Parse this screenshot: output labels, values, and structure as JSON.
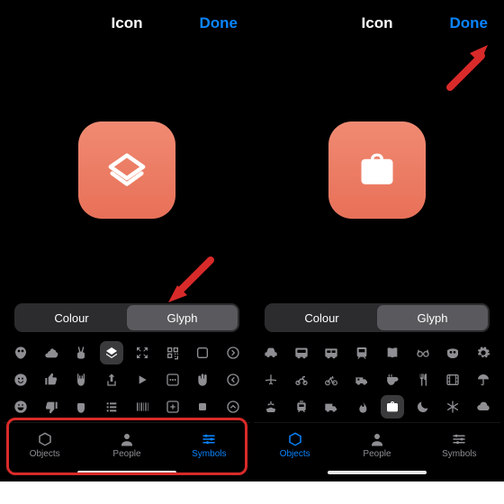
{
  "header": {
    "title": "Icon",
    "done": "Done"
  },
  "segmented": {
    "colour": "Colour",
    "glyph": "Glyph"
  },
  "tabs": {
    "objects": "Objects",
    "people": "People",
    "symbols": "Symbols"
  },
  "accent_color": "#ed7e66",
  "left": {
    "selected_glyph": "shortcuts-layers",
    "active_tab": "symbols"
  },
  "right": {
    "selected_glyph": "briefcase",
    "active_tab": "objects"
  }
}
